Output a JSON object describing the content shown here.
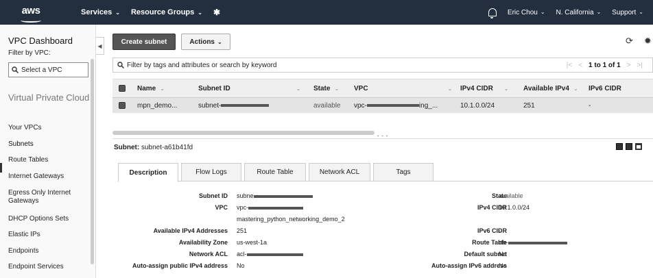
{
  "topbar": {
    "logo": "aws",
    "services_label": "Services",
    "resource_groups_label": "Resource Groups",
    "user_label": "Eric Chou",
    "region_label": "N. California",
    "support_label": "Support"
  },
  "sidebar": {
    "title": "VPC Dashboard",
    "filter_label": "Filter by VPC:",
    "select_placeholder": "Select a VPC",
    "section_title": "Virtual Private Cloud",
    "items": [
      {
        "label": "Your VPCs"
      },
      {
        "label": "Subnets"
      },
      {
        "label": "Route Tables"
      },
      {
        "label": "Internet Gateways"
      },
      {
        "label": "Egress Only Internet Gateways"
      },
      {
        "label": "DHCP Options Sets"
      },
      {
        "label": "Elastic IPs"
      },
      {
        "label": "Endpoints"
      },
      {
        "label": "Endpoint Services"
      }
    ]
  },
  "toolbar": {
    "create_label": "Create subnet",
    "actions_label": "Actions"
  },
  "filter": {
    "placeholder": "Filter by tags and attributes or search by keyword",
    "pagination": "1 to 1 of 1"
  },
  "table": {
    "headers": [
      "Name",
      "Subnet ID",
      "State",
      "VPC",
      "IPv4 CIDR",
      "Available IPv4",
      "IPv6 CIDR"
    ],
    "row": {
      "name": "mpn_demo...",
      "subnet_id": "subnet-",
      "state": "available",
      "vpc_prefix": "vpc-",
      "vpc_suffix": "ing_...",
      "ipv4_cidr": "10.1.0.0/24",
      "available_ipv4": "251",
      "ipv6_cidr": "-"
    }
  },
  "details": {
    "title_label": "Subnet:",
    "title_value": "subnet-a61b41fd",
    "tabs": [
      "Description",
      "Flow Logs",
      "Route Table",
      "Network ACL",
      "Tags"
    ],
    "left": [
      {
        "label": "Subnet ID",
        "value": "subne"
      },
      {
        "label": "VPC",
        "value": "vpc-",
        "value2": "mastering_python_networking_demo_2"
      },
      {
        "label": "Available IPv4 Addresses",
        "value": "251"
      },
      {
        "label": "Availability Zone",
        "value": "us-west-1a"
      },
      {
        "label": "Network ACL",
        "value": "acl-"
      },
      {
        "label": "Auto-assign public IPv4 address",
        "value": "No"
      }
    ],
    "right": [
      {
        "label": "State",
        "value": "available"
      },
      {
        "label": "IPv4 CIDR",
        "value": "10.1.0.0/24"
      },
      {
        "label": "IPv6 CIDR",
        "value": "-"
      },
      {
        "label": "Route Table",
        "value": "rtb-"
      },
      {
        "label": "Default subnet",
        "value": "No"
      },
      {
        "label": "Auto-assign IPv6 address",
        "value": "No"
      }
    ]
  }
}
